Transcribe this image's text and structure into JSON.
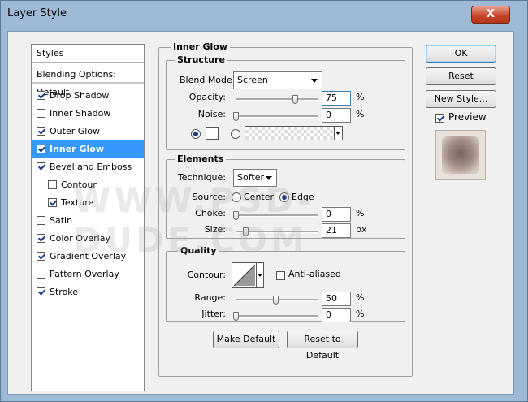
{
  "window": {
    "title": "Layer Style",
    "close_glyph": "X"
  },
  "styles_panel": {
    "header": "Styles",
    "blending": "Blending Options: Default",
    "items": [
      {
        "label": "Drop Shadow",
        "checked": true,
        "selected": false,
        "indent": false
      },
      {
        "label": "Inner Shadow",
        "checked": false,
        "selected": false,
        "indent": false
      },
      {
        "label": "Outer Glow",
        "checked": true,
        "selected": false,
        "indent": false
      },
      {
        "label": "Inner Glow",
        "checked": true,
        "selected": true,
        "indent": false
      },
      {
        "label": "Bevel and Emboss",
        "checked": true,
        "selected": false,
        "indent": false
      },
      {
        "label": "Contour",
        "checked": false,
        "selected": false,
        "indent": true
      },
      {
        "label": "Texture",
        "checked": true,
        "selected": false,
        "indent": true
      },
      {
        "label": "Satin",
        "checked": false,
        "selected": false,
        "indent": false
      },
      {
        "label": "Color Overlay",
        "checked": true,
        "selected": false,
        "indent": false
      },
      {
        "label": "Gradient Overlay",
        "checked": true,
        "selected": false,
        "indent": false
      },
      {
        "label": "Pattern Overlay",
        "checked": false,
        "selected": false,
        "indent": false
      },
      {
        "label": "Stroke",
        "checked": true,
        "selected": false,
        "indent": false
      }
    ]
  },
  "inner_glow": {
    "title": "Inner Glow",
    "structure": {
      "title": "Structure",
      "blend_mode_label": "Blend Mode:",
      "blend_mode_value": "Screen",
      "opacity_label": "Opacity:",
      "opacity_value": "75",
      "opacity_unit": "%",
      "noise_label": "Noise:",
      "noise_value": "0",
      "noise_unit": "%"
    },
    "elements": {
      "title": "Elements",
      "technique_label": "Technique:",
      "technique_value": "Softer",
      "source_label": "Source:",
      "source_center": "Center",
      "source_edge": "Edge",
      "choke_label": "Choke:",
      "choke_value": "0",
      "choke_unit": "%",
      "size_label": "Size:",
      "size_value": "21",
      "size_unit": "px"
    },
    "quality": {
      "title": "Quality",
      "contour_label": "Contour:",
      "antialiased_label": "Anti-aliased",
      "range_label": "Range:",
      "range_value": "50",
      "range_unit": "%",
      "jitter_label": "Jitter:",
      "jitter_value": "0",
      "jitter_unit": "%"
    },
    "make_default": "Make Default",
    "reset_default": "Reset to Default"
  },
  "actions": {
    "ok": "OK",
    "reset": "Reset",
    "new_style": "New Style...",
    "preview": "Preview"
  },
  "watermark": "WWW.PSD-DUDE.COM"
}
